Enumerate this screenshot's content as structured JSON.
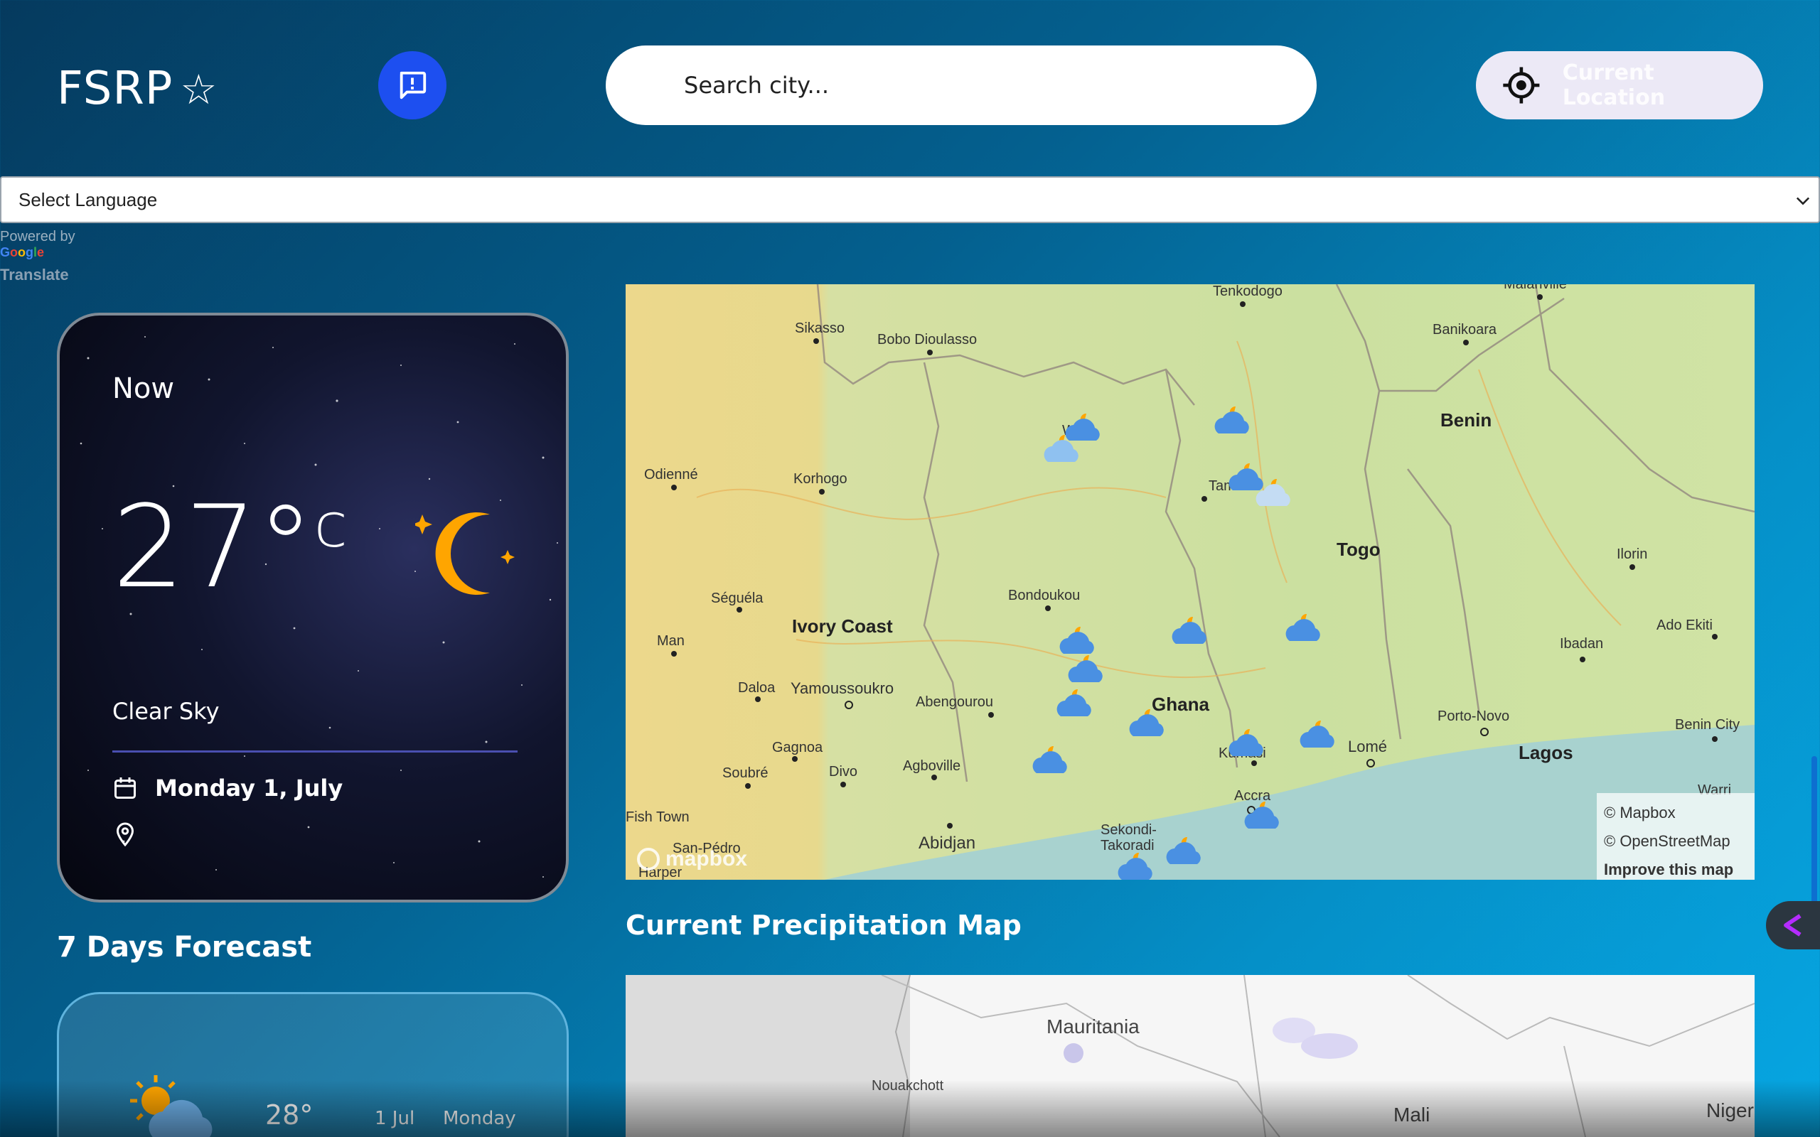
{
  "header": {
    "logo_text": "FSRP",
    "search_placeholder": "Search city...",
    "location_label": "Current Location"
  },
  "translate": {
    "select_label": "Select Language",
    "powered_by": "Powered by",
    "google": "Google",
    "translate": "Translate"
  },
  "now": {
    "label": "Now",
    "temp": "27°",
    "unit": "c",
    "description": "Clear Sky",
    "date": "Monday 1, July",
    "location": ""
  },
  "forecast": {
    "title": "7 Days Forecast",
    "items": [
      {
        "temp": "28°",
        "date": "1 Jul",
        "day": "Monday"
      }
    ]
  },
  "map": {
    "places": [
      "Tenkodogo",
      "Malanville",
      "Sikasso",
      "Bobo Dioulasso",
      "Banikoara",
      "Benin",
      "Wa",
      "Odienné",
      "Korhogo",
      "Tamale",
      "Togo",
      "Ilorin",
      "Séguéla",
      "Bondoukou",
      "Ivory Coast",
      "Ado Ekiti",
      "Man",
      "Ibadan",
      "Daloa",
      "Yamoussoukro",
      "Abengourou",
      "Ghana",
      "Porto-Novo",
      "Benin City",
      "Lagos",
      "Gagnoa",
      "Soubré",
      "Divo",
      "Agboville",
      "Lomé",
      "Kumasi",
      "Warri",
      "Accra",
      "Fish Town",
      "Abidjan",
      "Sekondi-Takoradi",
      "San-Pédro",
      "Harper"
    ],
    "attribution_mapbox": "© Mapbox",
    "attribution_osm": "© OpenStreetMap",
    "improve": "Improve this map",
    "logo": "mapbox"
  },
  "precip": {
    "title": "Current Precipitation Map",
    "places": [
      "Mauritania",
      "Nouakchott",
      "Mali",
      "Niger"
    ]
  },
  "colors": {
    "accent": "#1d4ff0",
    "moon": "#ffa500",
    "cloud": "#4a90e2"
  },
  "icons": {
    "feedback": "feedback-icon",
    "location": "crosshair-icon",
    "calendar": "calendar-icon",
    "pin": "map-pin-icon"
  }
}
